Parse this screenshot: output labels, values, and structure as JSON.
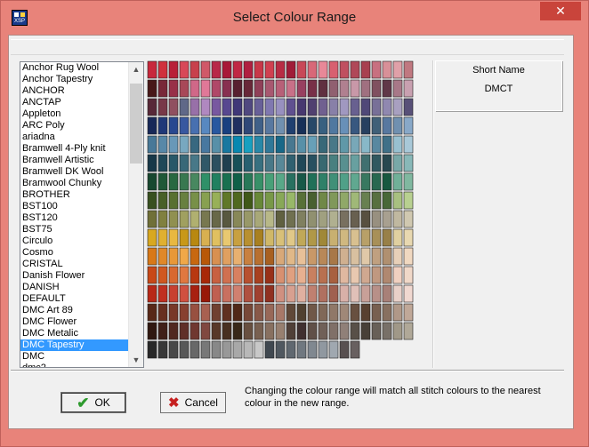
{
  "window": {
    "title": "Select Colour Range",
    "icon_label": "XSP",
    "close_glyph": "✕"
  },
  "ranges": {
    "items": [
      "Anchor Rug Wool",
      "Anchor Tapestry",
      "ANCHOR",
      "ANCTAP",
      "Appleton",
      "ARC Poly",
      "ariadna",
      "Bramwell 4-Ply knit",
      "Bramwell Artistic",
      "Bramwell DK Wool",
      "Bramwool Chunky",
      "BROTHER",
      "BST100",
      "BST120",
      "BST75",
      "Circulo",
      "Cosmo",
      "CRISTAL",
      "Danish Flower",
      "DANISH",
      "DEFAULT",
      "DMC Art 89",
      "DMC Flower",
      "DMC Metalic",
      "DMC Tapestry",
      "DMC",
      "dmc2"
    ],
    "selected": "DMC Tapestry"
  },
  "short_name": {
    "header": "Short Name",
    "value": "DMCT"
  },
  "buttons": {
    "ok": "OK",
    "cancel": "Cancel"
  },
  "message": "Changing the colour range will match all stitch colours to the nearest colour in the new range.",
  "swatch_rows": [
    [
      "#c8283c",
      "#d0303c",
      "#b82038",
      "#d84858",
      "#c8404c",
      "#d05868",
      "#b82848",
      "#a81838",
      "#c02844",
      "#b02040",
      "#c83848",
      "#d04050",
      "#b82c44",
      "#a01c38",
      "#c84858",
      "#d86878",
      "#e88898",
      "#d86070",
      "#c05060",
      "#b04858",
      "#a84050",
      "#c87080",
      "#d89098",
      "#e0a0a8",
      "#c07880"
    ],
    [
      "#481818",
      "#782838",
      "#983048",
      "#a84858",
      "#d06888",
      "#e07898",
      "#b04868",
      "#883050",
      "#582030",
      "#682838",
      "#904058",
      "#a85870",
      "#b86078",
      "#c87088",
      "#984060",
      "#783048",
      "#603040",
      "#906070",
      "#b08090",
      "#c898a8",
      "#a07080",
      "#805060",
      "#603848",
      "#a87888",
      "#c8a0b0"
    ],
    [
      "#582838",
      "#783848",
      "#905060",
      "#606888",
      "#9870a8",
      "#b088c0",
      "#7858a0",
      "#584890",
      "#403878",
      "#504880",
      "#686098",
      "#8078b0",
      "#9890c0",
      "#605090",
      "#483870",
      "#504070",
      "#706090",
      "#8880a8",
      "#a098c0",
      "#686090",
      "#504878",
      "#787098",
      "#9088b0",
      "#a8a0c0",
      "#585078"
    ],
    [
      "#182858",
      "#203878",
      "#284890",
      "#3858a0",
      "#4870b0",
      "#5888c0",
      "#2858a0",
      "#184080",
      "#203060",
      "#304878",
      "#406088",
      "#5878a0",
      "#7090b0",
      "#204070",
      "#183058",
      "#284868",
      "#386080",
      "#5078a0",
      "#6890b8",
      "#385880",
      "#284060",
      "#406078",
      "#5878a0",
      "#7090b0",
      "#88a8c8"
    ],
    [
      "#487898",
      "#5888a8",
      "#6898b8",
      "#78a8c0",
      "#386880",
      "#4878a0",
      "#5890a8",
      "#1878a0",
      "#0888b0",
      "#18a0c0",
      "#2888a8",
      "#307898",
      "#186888",
      "#487890",
      "#5890a8",
      "#68a0b8",
      "#386878",
      "#487888",
      "#6098a8",
      "#78a8b8",
      "#88b8c8",
      "#5888a0",
      "#407088",
      "#98c0d0",
      "#a8c8d8"
    ],
    [
      "#183848",
      "#204858",
      "#285868",
      "#386878",
      "#487888",
      "#305868",
      "#2c5060",
      "#204050",
      "#185058",
      "#286070",
      "#387080",
      "#487888",
      "#588898",
      "#306070",
      "#204858",
      "#285060",
      "#386870",
      "#488080",
      "#589090",
      "#68a0a0",
      "#407070",
      "#305860",
      "#284850",
      "#78a8a8",
      "#88b8b8"
    ],
    [
      "#184830",
      "#205838",
      "#286840",
      "#387850",
      "#488860",
      "#309068",
      "#208060",
      "#187050",
      "#106048",
      "#287858",
      "#389068",
      "#48a078",
      "#58a888",
      "#287060",
      "#185848",
      "#207058",
      "#308068",
      "#409078",
      "#50a088",
      "#60a890",
      "#387860",
      "#286850",
      "#185840",
      "#70b098",
      "#80b8a0"
    ],
    [
      "#385020",
      "#486028",
      "#587030",
      "#688040",
      "#789048",
      "#88a050",
      "#98b058",
      "#607828",
      "#506820",
      "#405818",
      "#688838",
      "#789848",
      "#88a858",
      "#98b868",
      "#587038",
      "#486030",
      "#708848",
      "#80985a",
      "#90a868",
      "#a0b878",
      "#688050",
      "#587040",
      "#486838",
      "#a8c080",
      "#b8d090"
    ],
    [
      "#707038",
      "#808040",
      "#909050",
      "#a0a060",
      "#b0b070",
      "#787850",
      "#686848",
      "#585840",
      "#888858",
      "#989868",
      "#a8a878",
      "#b8b888",
      "#606040",
      "#707050",
      "#808060",
      "#909070",
      "#a0a080",
      "#b0b090",
      "#787060",
      "#686050",
      "#585040",
      "#989080",
      "#a8a090",
      "#c0b8a0",
      "#d0c8b0"
    ],
    [
      "#d8a820",
      "#e0b030",
      "#e8b840",
      "#c89818",
      "#b88810",
      "#d8b050",
      "#e0c060",
      "#e8c870",
      "#c8a040",
      "#b89030",
      "#a88020",
      "#d0b868",
      "#d8c078",
      "#e0c888",
      "#c0a858",
      "#b09848",
      "#a08838",
      "#c8b070",
      "#d0b880",
      "#d8c090",
      "#b8a068",
      "#a89058",
      "#988048",
      "#e0d0a0",
      "#e8d8b0"
    ],
    [
      "#d87818",
      "#e08828",
      "#e89838",
      "#f0a848",
      "#c86810",
      "#b85808",
      "#d89050",
      "#e0a060",
      "#e8b070",
      "#c88040",
      "#b87030",
      "#a86020",
      "#d8a878",
      "#e0b888",
      "#e8c098",
      "#c89868",
      "#b88858",
      "#a87848",
      "#d0b090",
      "#d8c0a0",
      "#e0c8a8",
      "#c0a080",
      "#b09070",
      "#e8d0b8",
      "#f0d8c0"
    ],
    [
      "#c84818",
      "#d05820",
      "#d86830",
      "#e07840",
      "#b83810",
      "#a82808",
      "#c86040",
      "#d07050",
      "#d88060",
      "#b85030",
      "#a84020",
      "#983018",
      "#d89070",
      "#e0a080",
      "#e8b090",
      "#c88060",
      "#b87050",
      "#a86040",
      "#e0b8a0",
      "#e8c8b0",
      "#d0a890",
      "#c09880",
      "#b08870",
      "#f0d0c0",
      "#f0d8c8"
    ],
    [
      "#b82818",
      "#c03020",
      "#c84030",
      "#d05040",
      "#a82010",
      "#981808",
      "#c06050",
      "#c87060",
      "#d08070",
      "#b05040",
      "#a04030",
      "#903020",
      "#d09080",
      "#d8a090",
      "#e0b0a0",
      "#c08070",
      "#b07060",
      "#a06050",
      "#d8b0a8",
      "#e0c0b8",
      "#c8a098",
      "#b89088",
      "#a88078",
      "#e8d0c8",
      "#f0d8d0"
    ],
    [
      "#582818",
      "#683020",
      "#783828",
      "#884030",
      "#985040",
      "#a86050",
      "#704030",
      "#603020",
      "#502818",
      "#784838",
      "#885848",
      "#986858",
      "#a87868",
      "#604838",
      "#504030",
      "#705848",
      "#806858",
      "#907868",
      "#a08878",
      "#685040",
      "#584030",
      "#786050",
      "#887060",
      "#b09888",
      "#c0a898"
    ],
    [
      "#301810",
      "#402018",
      "#502820",
      "#603028",
      "#703830",
      "#804840",
      "#583828",
      "#483020",
      "#382818",
      "#685040",
      "#786050",
      "#887060",
      "#988070",
      "#504038",
      "#403030",
      "#605048",
      "#706058",
      "#807068",
      "#908078",
      "#585048",
      "#484038",
      "#686058",
      "#787068",
      "#a09888",
      "#b0a898"
    ],
    [
      "#282828",
      "#383838",
      "#484848",
      "#585858",
      "#686868",
      "#787878",
      "#888888",
      "#989898",
      "#a8a8a8",
      "#b8b8b8",
      "#c8c8c8",
      "#404850",
      "#505860",
      "#606870",
      "#707880",
      "#808890",
      "#9098a0",
      "#a0a8b0",
      "#585050",
      "#686060"
    ]
  ]
}
